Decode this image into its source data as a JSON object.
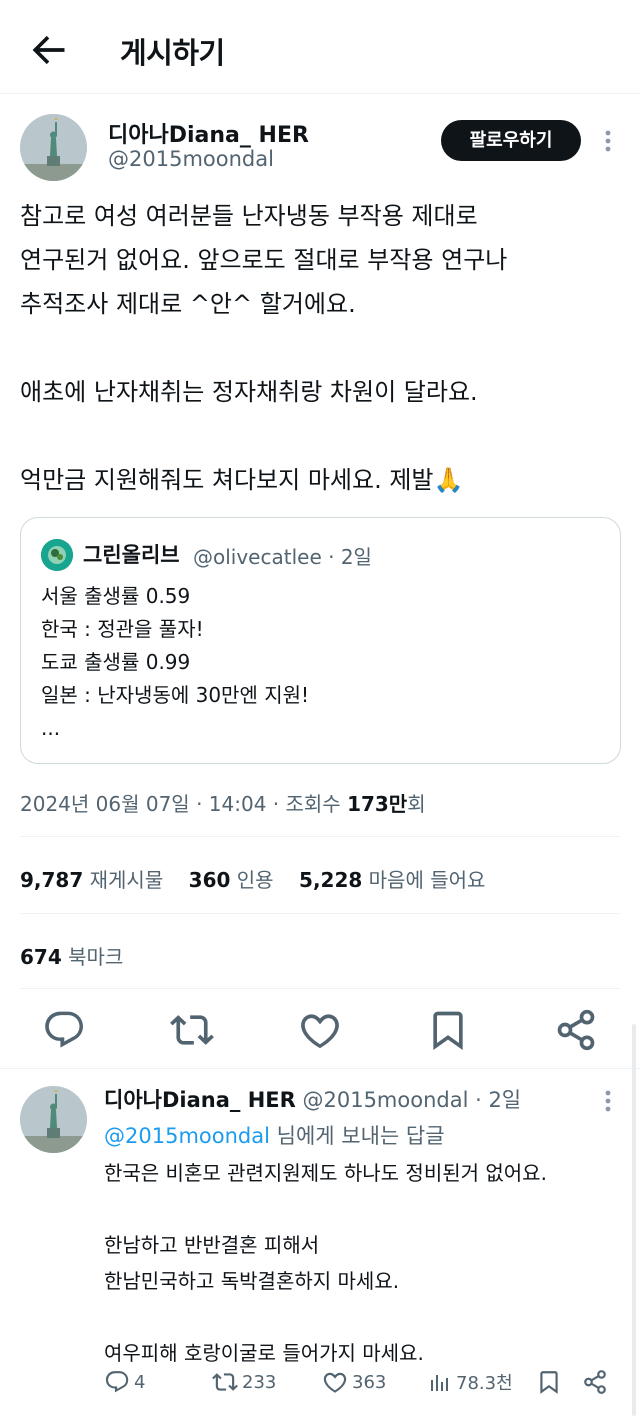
{
  "header": {
    "title": "게시하기"
  },
  "main_tweet": {
    "display_name": "디아나Diana_ HER",
    "handle": "@2015moondal",
    "follow_label": "팔로우하기",
    "text_lines": [
      "참고로 여성 여러분들 난자냉동 부작용 제대로",
      "연구된거 없어요. 앞으로도 절대로 부작용 연구나",
      "추적조사 제대로 ^안^ 할거에요.",
      "",
      "애초에 난자채취는 정자채취랑 차원이 달라요.",
      "",
      "억만금 지원해줘도 쳐다보지 마세요. 제발🙏"
    ],
    "quote": {
      "display_name": "그린올리브",
      "meta": "@olivecatlee · 2일",
      "lines": [
        "서울 출생률 0.59",
        "한국 : 정관을 풀자!",
        "도쿄 출생률 0.99",
        "일본 : 난자냉동에 30만엔 지원!",
        "..."
      ]
    },
    "timestamp": "2024년 06월 07일 · 14:04 · 조회수 ",
    "views_value": "173만",
    "views_suffix": "회",
    "stats": {
      "retweets": "9,787",
      "retweets_label": "재게시물",
      "quotes": "360",
      "quotes_label": "인용",
      "likes": "5,228",
      "likes_label": "마음에 들어요",
      "bookmarks": "674",
      "bookmarks_label": "북마크"
    }
  },
  "reply": {
    "display_name": "디아나Diana_ HER",
    "meta": "@2015moondal · 2일",
    "reply_to_handle": "@2015moondal",
    "reply_to_suffix": " 님에게 보내는 답글",
    "lines": [
      "한국은 비혼모 관련지원제도 하나도 정비된거 없어요.",
      "",
      "한남하고 반반결혼 피해서",
      "한남민국하고 독박결혼하지 마세요.",
      "",
      "여우피해 호랑이굴로 들어가지 마세요."
    ],
    "actions": {
      "replies": "4",
      "retweets": "233",
      "likes": "363",
      "views": "78.3천"
    }
  },
  "colors": {
    "accent": "#1d9bf0",
    "text": "#0f1419",
    "muted": "#536471"
  }
}
